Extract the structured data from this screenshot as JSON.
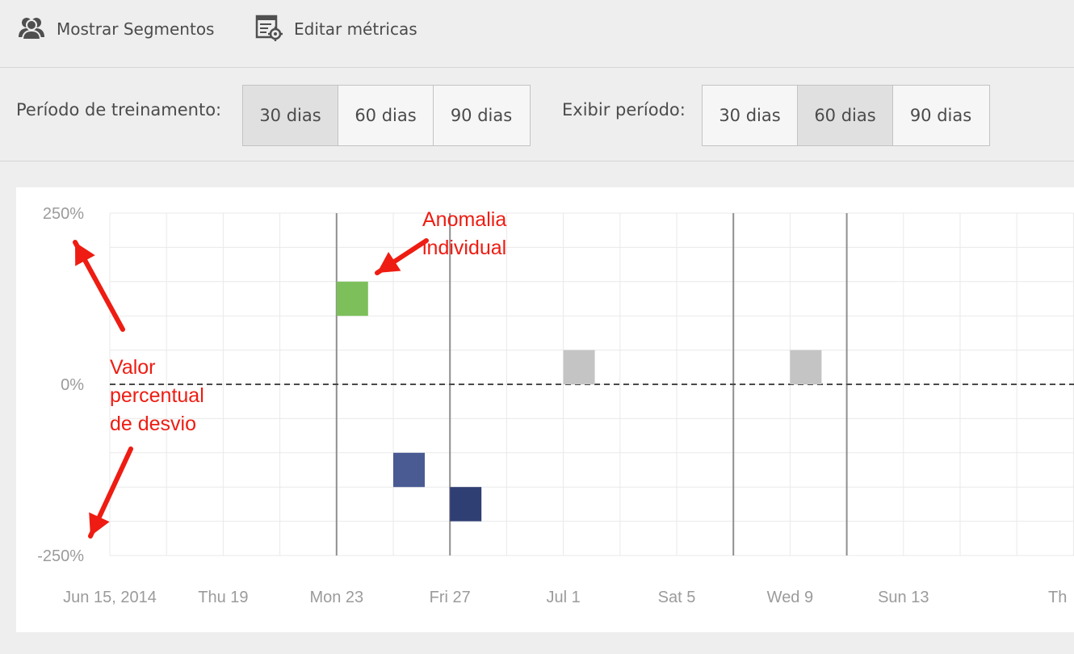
{
  "toolbar": {
    "show_segments_label": "Mostrar Segmentos",
    "edit_metrics_label": "Editar métricas",
    "icons": [
      "users-icon",
      "metrics-settings-icon"
    ]
  },
  "training_period": {
    "label": "Período de treinamento:",
    "options": [
      "30 dias",
      "60 dias",
      "90 dias"
    ],
    "selected": "30 dias"
  },
  "display_period": {
    "label": "Exibir período:",
    "options": [
      "30 dias",
      "60 dias",
      "90 dias"
    ],
    "selected": "60 dias"
  },
  "colors": {
    "positive_anomaly": "#7dc05b",
    "negative_anomaly_light": "#4a5a93",
    "negative_anomaly_dark": "#2f3e73",
    "neutral": "#c4c4c4",
    "annotation": "#ee1c12"
  },
  "chart_data": {
    "type": "scatter",
    "ylabel": "",
    "ylim": [
      -250,
      250
    ],
    "y_ticks": [
      "250%",
      "0%",
      "-250%"
    ],
    "x_tick_labels": [
      "Jun 15, 2014",
      "Thu 19",
      "Mon 23",
      "Fri 27",
      "Jul 1",
      "Sat 5",
      "Wed 9",
      "Sun 13",
      "Th"
    ],
    "grid": true,
    "zero_line": "dashed",
    "points": [
      {
        "date": "2014-06-23",
        "deviation_pct": 150,
        "kind": "positive"
      },
      {
        "date": "2014-06-25",
        "deviation_pct": -150,
        "kind": "negative"
      },
      {
        "date": "2014-06-27",
        "deviation_pct": -200,
        "kind": "negative"
      },
      {
        "date": "2014-07-01",
        "deviation_pct": 50,
        "kind": "neutral"
      },
      {
        "date": "2014-07-09",
        "deviation_pct": 50,
        "kind": "neutral"
      }
    ],
    "annotations": [
      {
        "label": "Anomalia individual",
        "lines": [
          "Anomalia",
          "individual"
        ]
      },
      {
        "label": "Valor percentual de desvio",
        "lines": [
          "Valor",
          "percentual",
          "de desvio"
        ]
      }
    ]
  }
}
